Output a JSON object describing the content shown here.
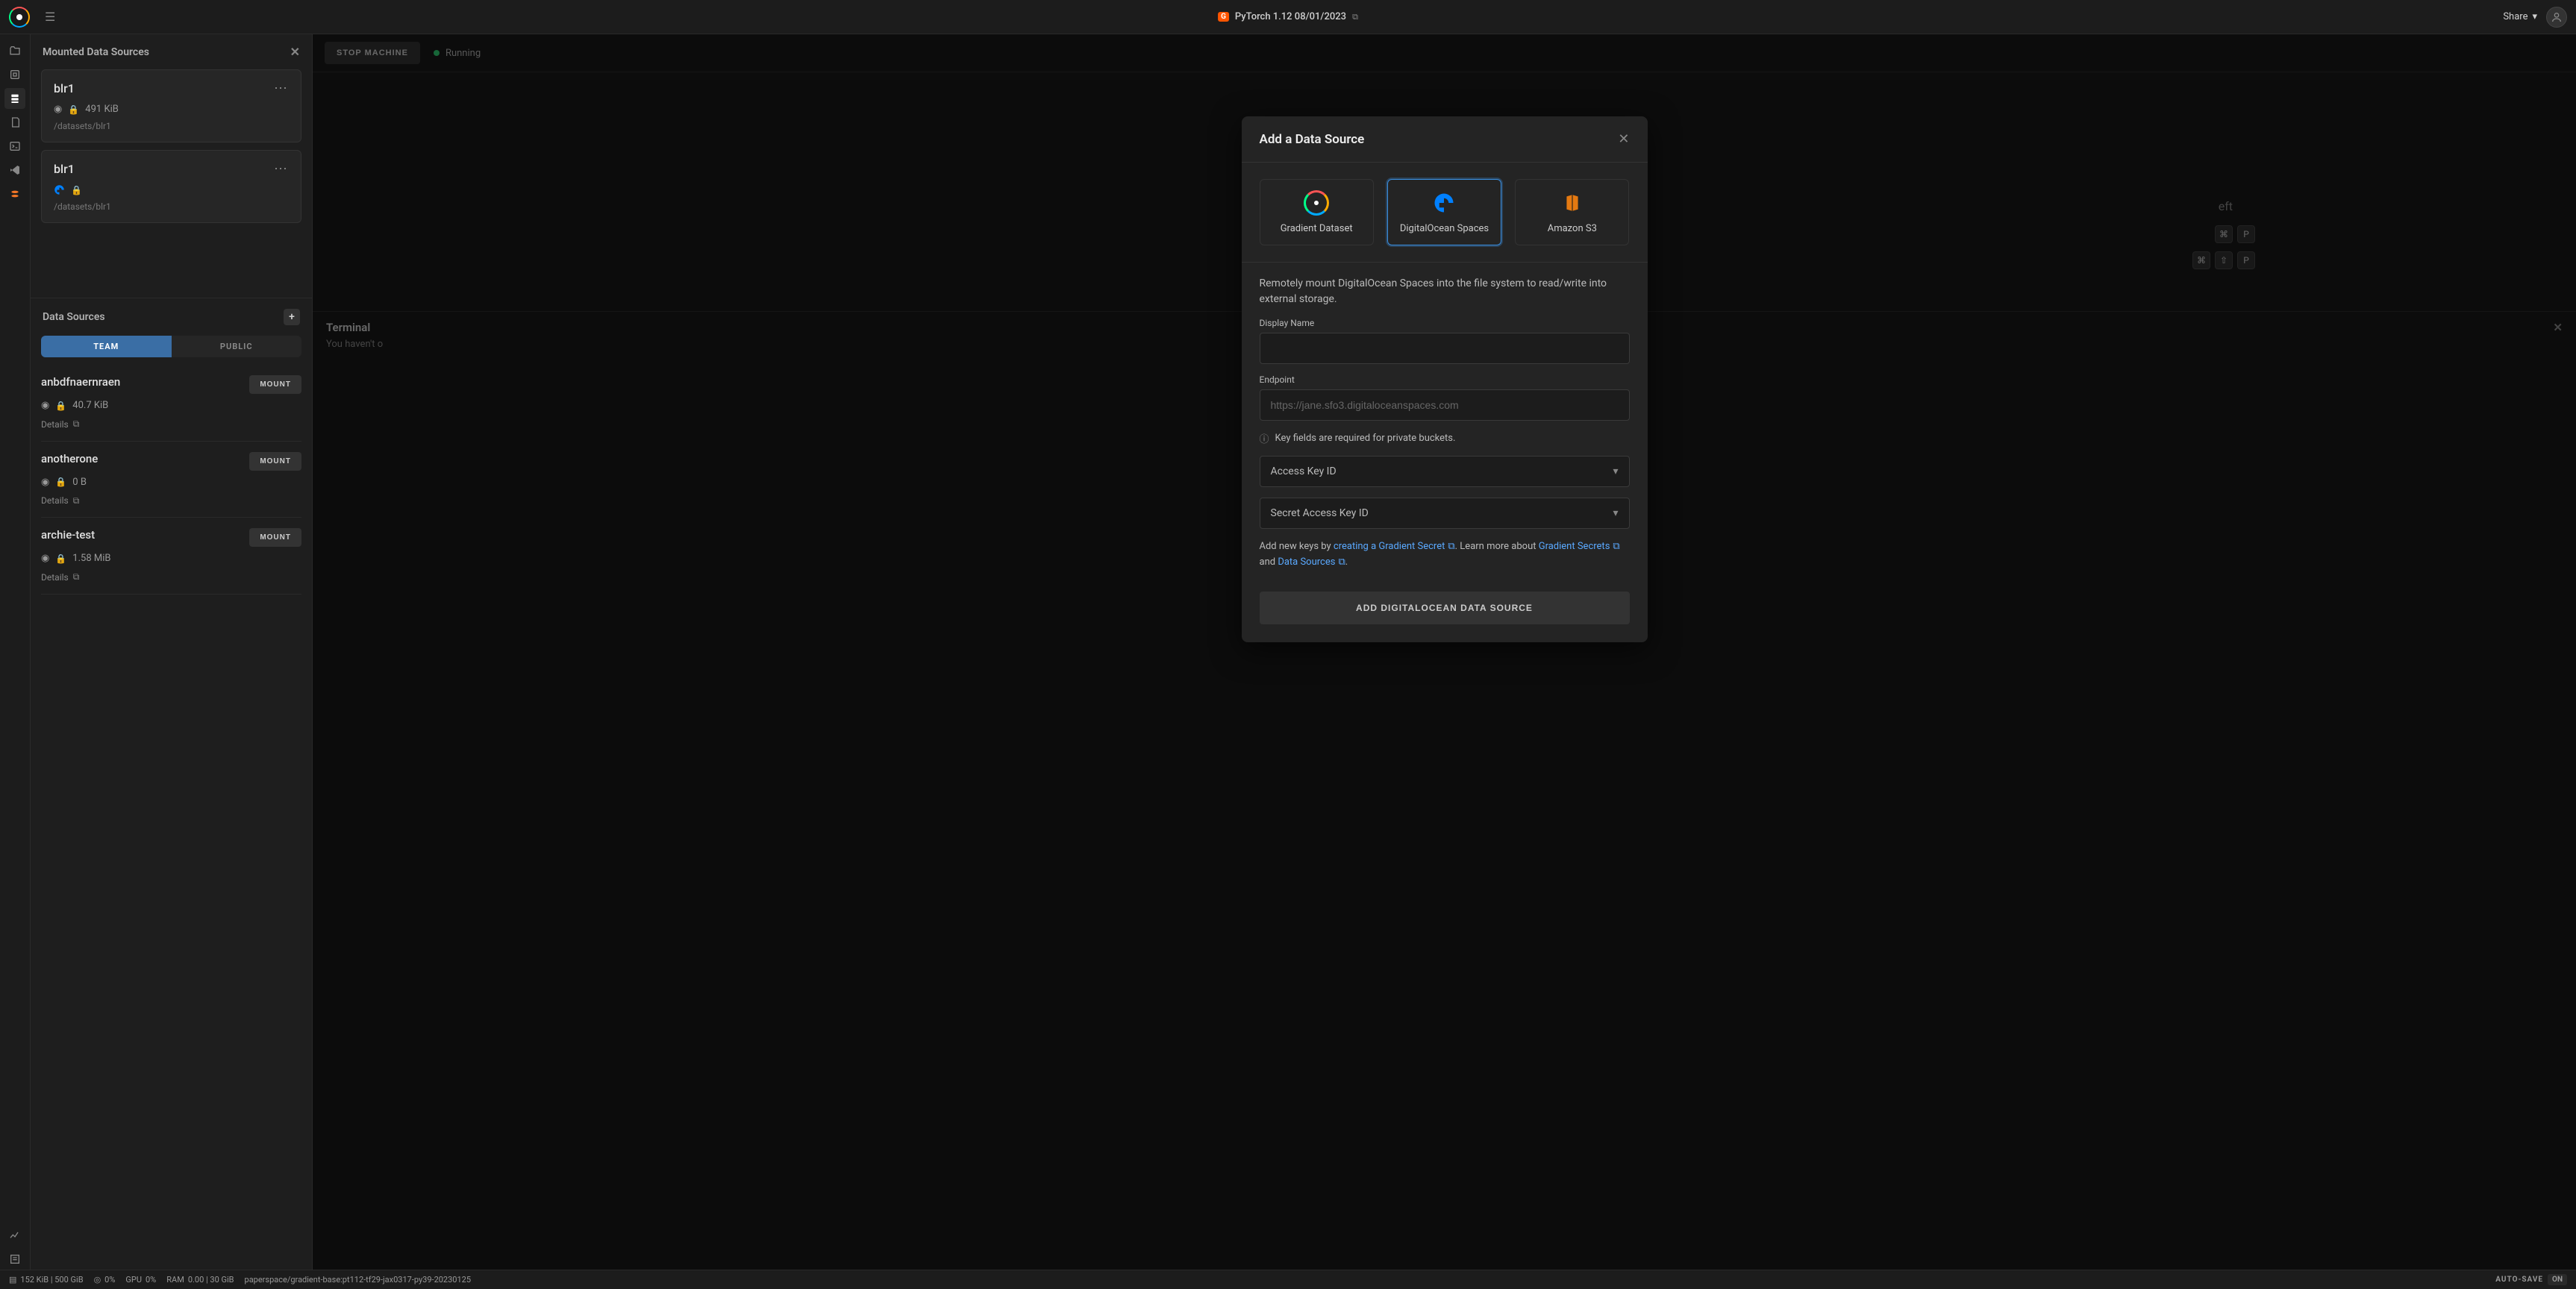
{
  "header": {
    "title": "PyTorch 1.12 08/01/2023",
    "badge": "G",
    "share_label": "Share"
  },
  "sidebar": {
    "mounted_header": "Mounted Data Sources",
    "mounted": [
      {
        "name": "blr1",
        "size": "491 KiB",
        "path": "/datasets/blr1",
        "provider": "gradient"
      },
      {
        "name": "blr1",
        "size": "",
        "path": "/datasets/blr1",
        "provider": "digitalocean"
      }
    ],
    "sources_header": "Data Sources",
    "tabs": {
      "team": "TEAM",
      "public": "PUBLIC"
    },
    "items": [
      {
        "name": "anbdfnaernraen",
        "size": "40.7 KiB",
        "details": "Details",
        "mount": "MOUNT"
      },
      {
        "name": "anotherone",
        "size": "0 B",
        "details": "Details",
        "mount": "MOUNT"
      },
      {
        "name": "archie-test",
        "size": "1.58 MiB",
        "details": "Details",
        "mount": "MOUNT"
      }
    ]
  },
  "content": {
    "stop_label": "STOP MACHINE",
    "status": "Running",
    "hint_trailing": "eft",
    "terminal_header": "Terminal",
    "terminal_sub": "You haven't o"
  },
  "modal": {
    "title": "Add a Data Source",
    "providers": {
      "gradient": "Gradient Dataset",
      "do": "DigitalOcean Spaces",
      "s3": "Amazon S3"
    },
    "description": "Remotely mount DigitalOcean Spaces into the file system to read/write into external storage.",
    "display_name_label": "Display Name",
    "endpoint_label": "Endpoint",
    "endpoint_placeholder": "https://jane.sfo3.digitaloceanspaces.com",
    "key_info": "Key fields are required for private buckets.",
    "access_key_label": "Access Key ID",
    "secret_key_label": "Secret Access Key ID",
    "help_prefix": "Add new keys by ",
    "help_link1": "creating a Gradient Secret",
    "help_mid": ". Learn more about ",
    "help_link2": "Gradient Secrets",
    "help_and": " and ",
    "help_link3": "Data Sources",
    "help_end": ".",
    "submit": "ADD DIGITALOCEAN DATA SOURCE"
  },
  "statusbar": {
    "disk": "152 KiB | 500 GiB",
    "cpu": "0%",
    "gpu_label": "GPU",
    "gpu": "0%",
    "ram_label": "RAM",
    "ram": "0.00 | 30 GiB",
    "image": "paperspace/gradient-base:pt112-tf29-jax0317-py39-20230125",
    "autosave_label": "AUTO-SAVE",
    "autosave_state": "ON"
  }
}
